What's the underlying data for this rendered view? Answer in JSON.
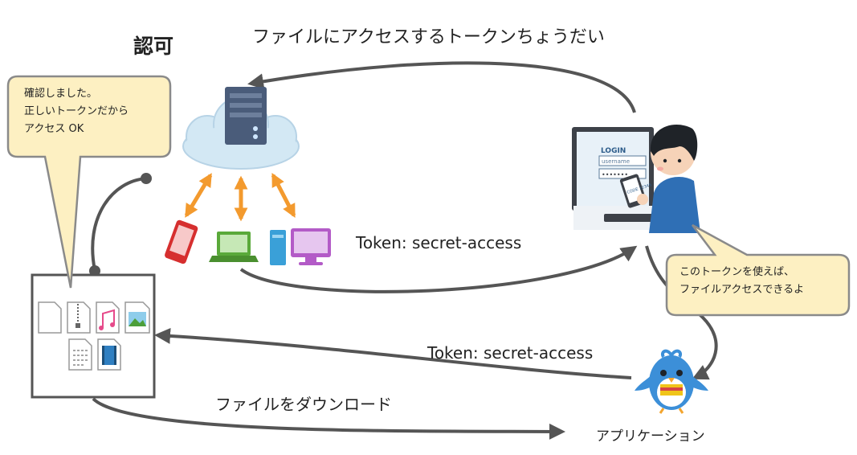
{
  "title": "認可",
  "arrow_labels": {
    "request": "ファイルにアクセスするトークンちょうだい",
    "token_to_user": "Token: secret-access",
    "token_to_storage": "Token: secret-access",
    "download": "ファイルをダウンロード"
  },
  "nodes": {
    "application": "アプリケーション"
  },
  "bubbles": {
    "storage": [
      "確認しました。",
      "正しいトークンだから",
      "アクセス OK"
    ],
    "user": [
      "このトークンを使えば、",
      "ファイルアクセスできるよ"
    ]
  },
  "screen_text": {
    "login": "LOGIN",
    "username": "username",
    "password": "•••••••",
    "phone_code": "CODE 12345"
  },
  "colors": {
    "arrow": "#555555",
    "double_arrow": "#f39a2e",
    "bubble_fill": "#fdf0c2",
    "bubble_stroke": "#8a8a8a",
    "cloud": "#d3e8f4",
    "server": "#4a5c7a",
    "bird": "#3c8fd8"
  },
  "icons": [
    "server-icon",
    "cloud-icon",
    "smartphone-icon",
    "laptop-icon",
    "desktop-pc-icon",
    "user-icon",
    "monitor-icon",
    "bird-app-icon",
    "document-icon",
    "zip-file-icon",
    "music-file-icon",
    "image-file-icon",
    "text-file-icon",
    "video-file-icon"
  ]
}
